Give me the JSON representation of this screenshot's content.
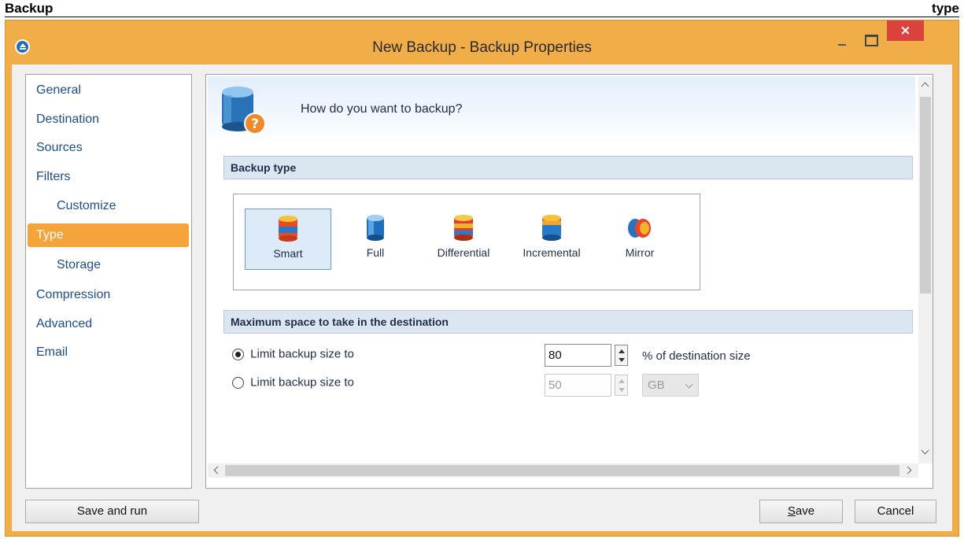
{
  "doc_header": {
    "left": "Backup",
    "right": "type"
  },
  "window": {
    "title": "New Backup - Backup Properties",
    "close_glyph": "×"
  },
  "nav": {
    "items": [
      {
        "label": "General"
      },
      {
        "label": "Destination"
      },
      {
        "label": "Sources"
      },
      {
        "label": "Filters"
      },
      {
        "label": "Customize"
      },
      {
        "label": "Type"
      },
      {
        "label": "Storage"
      },
      {
        "label": "Compression"
      },
      {
        "label": "Advanced"
      },
      {
        "label": "Email"
      }
    ],
    "active": "Type"
  },
  "panel": {
    "question": "How do you want to backup?",
    "backup_type_section": "Backup type",
    "types": [
      {
        "label": "Smart",
        "icon": "smart-icon",
        "selected": true
      },
      {
        "label": "Full",
        "icon": "full-icon",
        "selected": false
      },
      {
        "label": "Differential",
        "icon": "differential-icon",
        "selected": false
      },
      {
        "label": "Incremental",
        "icon": "incremental-icon",
        "selected": false
      },
      {
        "label": "Mirror",
        "icon": "mirror-icon",
        "selected": false
      }
    ],
    "space_section": "Maximum space to take in the destination",
    "limit_percent": {
      "label": "Limit backup size to",
      "value": "80",
      "unit": "% of destination size",
      "checked": true
    },
    "limit_size": {
      "label": "Limit backup size to",
      "value": "50",
      "unit": "GB",
      "checked": false
    }
  },
  "buttons": {
    "save_and_run": "Save and run",
    "save_mnemonic": "S",
    "save_rest": "ave",
    "cancel": "Cancel"
  },
  "colors": {
    "accent": "#f5a43b",
    "frame": "#f0ad48",
    "close": "#d9433b"
  }
}
